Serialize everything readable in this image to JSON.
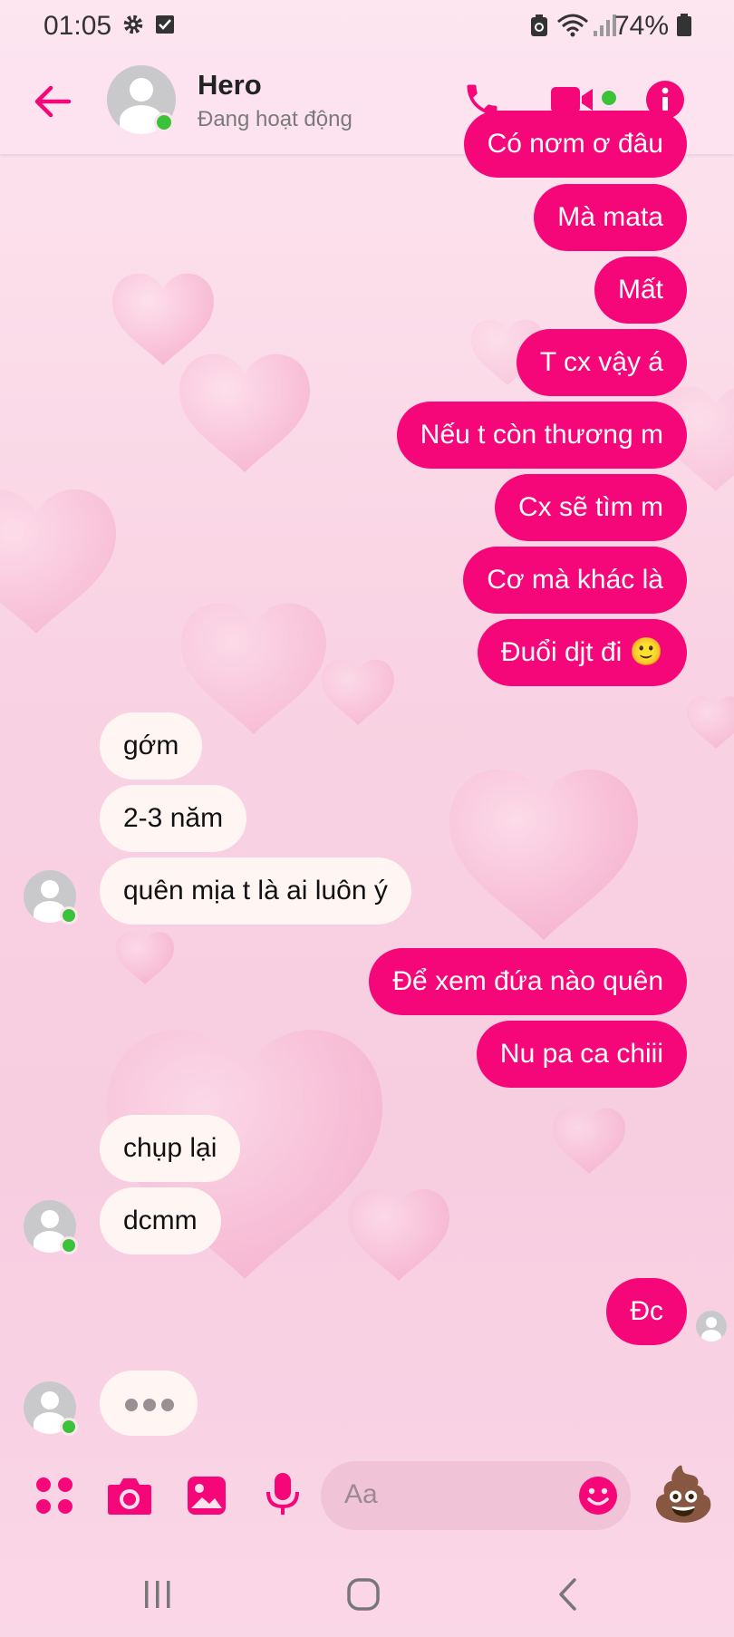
{
  "status_bar": {
    "time": "01:05",
    "battery": "74%"
  },
  "header": {
    "contact_name": "Hero",
    "status": "Đang hoạt động"
  },
  "messages": [
    {
      "from": "me",
      "text": "Có nơm ơ đâu",
      "partial": true
    },
    {
      "from": "me",
      "text": "Mà mata"
    },
    {
      "from": "me",
      "text": "Mất"
    },
    {
      "from": "me",
      "text": "T cx vậy á"
    },
    {
      "from": "me",
      "text": "Nếu t còn thương m"
    },
    {
      "from": "me",
      "text": "Cx sẽ tìm m"
    },
    {
      "from": "me",
      "text": "Cơ mà khác là"
    },
    {
      "from": "me",
      "text": "Đuổi djt đi 🙂"
    },
    {
      "from": "them",
      "text": "gớm"
    },
    {
      "from": "them",
      "text": "2-3 năm"
    },
    {
      "from": "them",
      "text": "quên mịa t là ai luôn ý"
    },
    {
      "from": "me",
      "text": "Để xem đứa nào quên"
    },
    {
      "from": "me",
      "text": "Nu pa ca chiii"
    },
    {
      "from": "them",
      "text": "chụp lại"
    },
    {
      "from": "them",
      "text": "dcmm"
    },
    {
      "from": "me",
      "text": "Đc"
    }
  ],
  "composer": {
    "placeholder": "Aa",
    "quick_reaction": "💩"
  },
  "colors": {
    "accent": "#f5077a",
    "online": "#3ac33a"
  },
  "icons": [
    "back-arrow-icon",
    "phone-icon",
    "video-camera-icon",
    "info-icon",
    "apps-icon",
    "camera-icon",
    "gallery-icon",
    "microphone-icon",
    "emoji-icon"
  ]
}
